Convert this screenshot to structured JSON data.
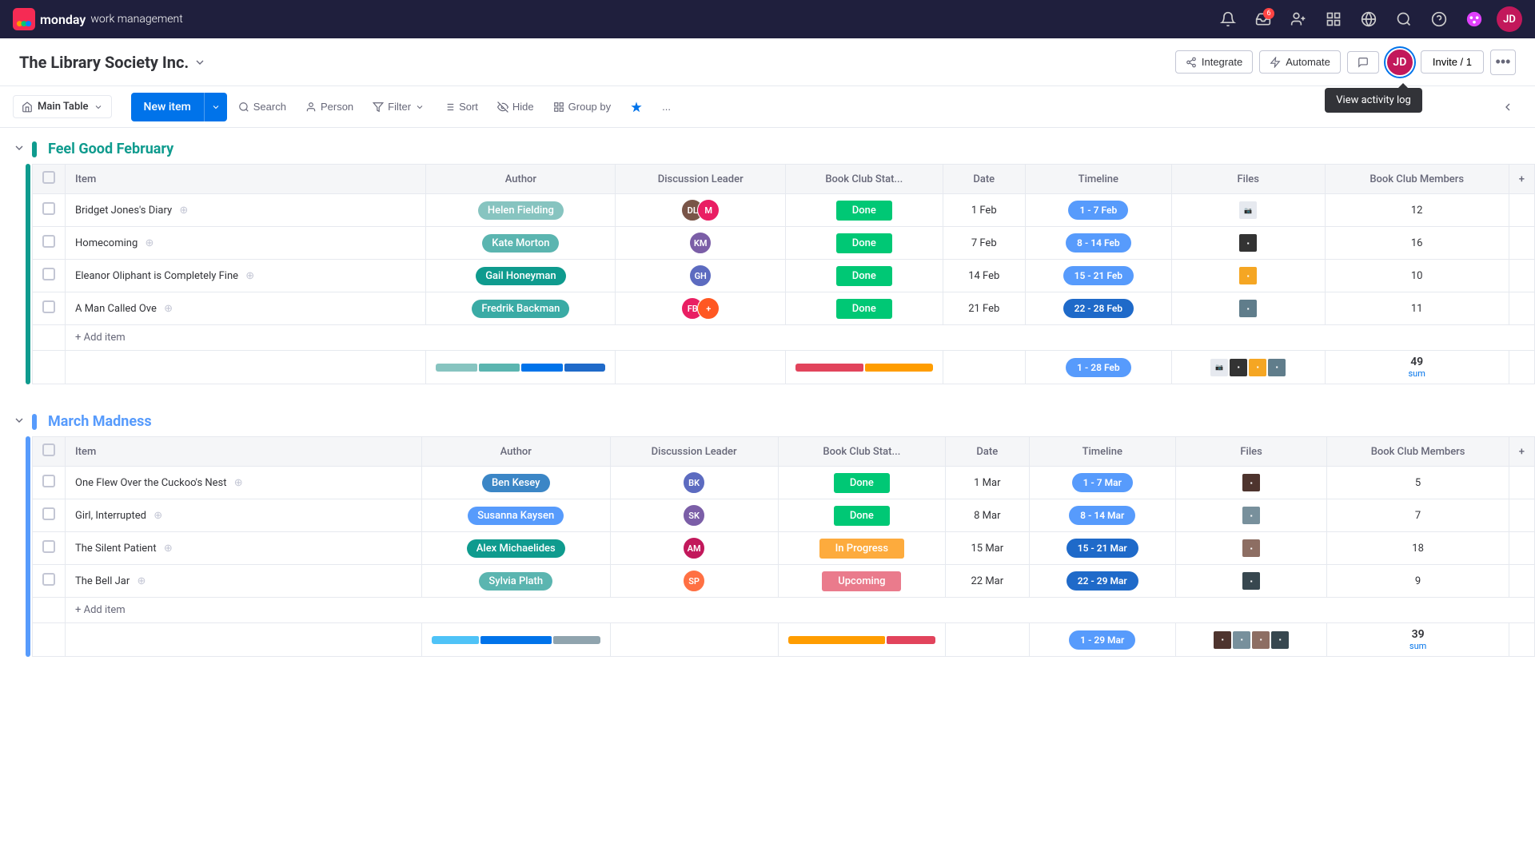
{
  "app": {
    "name": "monday",
    "subtitle": "work management"
  },
  "workspace": {
    "title": "The Library Society Inc.",
    "integrate_label": "Integrate",
    "automate_label": "Automate",
    "invite_label": "Invite / 1"
  },
  "toolbar": {
    "table_label": "Main Table",
    "new_item_label": "New item",
    "search_label": "Search",
    "person_label": "Person",
    "filter_label": "Filter",
    "sort_label": "Sort",
    "hide_label": "Hide",
    "group_by_label": "Group by",
    "more_label": "..."
  },
  "activity_log": {
    "label": "View activity log"
  },
  "groups": [
    {
      "id": "feel_good_feb",
      "title": "Feel Good February",
      "color": "teal",
      "columns": [
        "Item",
        "Author",
        "Discussion Leader",
        "Book Club Stat...",
        "Date",
        "Timeline",
        "Files",
        "Book Club Members"
      ],
      "rows": [
        {
          "item": "Bridget Jones's Diary",
          "author": "Helen Fielding",
          "author_color": "teal-light",
          "discussion_leader_initials": "DL",
          "status": "Done",
          "status_class": "done",
          "date": "1 Feb",
          "timeline": "1 - 7 Feb",
          "timeline_class": "blue",
          "files_count": 1,
          "members": 12
        },
        {
          "item": "Homecoming",
          "author": "Kate Morton",
          "author_color": "teal-lighter",
          "discussion_leader_initials": "KM",
          "status": "Done",
          "status_class": "done",
          "date": "7 Feb",
          "timeline": "8 - 14 Feb",
          "timeline_class": "blue",
          "files_count": 1,
          "members": 16
        },
        {
          "item": "Eleanor Oliphant is Completely Fine",
          "author": "Gail Honeyman",
          "author_color": "teal",
          "discussion_leader_initials": "GH",
          "status": "Done",
          "status_class": "done",
          "date": "14 Feb",
          "timeline": "15 - 21 Feb",
          "timeline_class": "blue",
          "files_count": 1,
          "members": 10
        },
        {
          "item": "A Man Called Ove",
          "author": "Fredrik Backman",
          "author_color": "teal-mid",
          "discussion_leader_initials": "FB",
          "status": "Done",
          "status_class": "done",
          "date": "21 Feb",
          "timeline": "22 - 28 Feb",
          "timeline_class": "dark-blue",
          "files_count": 1,
          "members": 11
        }
      ],
      "summary_timeline": "1 - 28 Feb",
      "summary_members": 49
    },
    {
      "id": "march_madness",
      "title": "March Madness",
      "color": "blue",
      "columns": [
        "Item",
        "Author",
        "Discussion Leader",
        "Book Club Stat...",
        "Date",
        "Timeline",
        "Files",
        "Book Club Members"
      ],
      "rows": [
        {
          "item": "One Flew Over the Cuckoo's Nest",
          "author": "Ben Kesey",
          "author_color": "blue-dark",
          "discussion_leader_initials": "BK",
          "status": "Done",
          "status_class": "done",
          "date": "1 Mar",
          "timeline": "1 - 7 Mar",
          "timeline_class": "blue",
          "files_count": 1,
          "members": 5
        },
        {
          "item": "Girl, Interrupted",
          "author": "Susanna Kaysen",
          "author_color": "blue",
          "discussion_leader_initials": "SK",
          "status": "Done",
          "status_class": "done",
          "date": "8 Mar",
          "timeline": "8 - 14 Mar",
          "timeline_class": "blue",
          "files_count": 1,
          "members": 7
        },
        {
          "item": "The Silent Patient",
          "author": "Alex Michaelides",
          "author_color": "teal",
          "discussion_leader_initials": "AM",
          "status": "In Progress",
          "status_class": "in-progress",
          "date": "15 Mar",
          "timeline": "15 - 21 Mar",
          "timeline_class": "dark-blue",
          "files_count": 1,
          "members": 18
        },
        {
          "item": "The Bell Jar",
          "author": "Sylvia Plath",
          "author_color": "teal-lighter",
          "discussion_leader_initials": "SP",
          "status": "Upcoming",
          "status_class": "upcoming",
          "date": "22 Mar",
          "timeline": "22 - 29 Mar",
          "timeline_class": "dark-blue",
          "files_count": 1,
          "members": 9
        }
      ],
      "summary_timeline": "1 - 29 Mar",
      "summary_members": 39
    }
  ],
  "nav_icons": [
    {
      "name": "bell-icon",
      "symbol": "🔔"
    },
    {
      "name": "inbox-icon",
      "symbol": "📥"
    },
    {
      "name": "invite-icon",
      "symbol": "👤"
    },
    {
      "name": "apps-icon",
      "symbol": "⊞"
    },
    {
      "name": "globe-icon",
      "symbol": "🌐"
    },
    {
      "name": "search-icon",
      "symbol": "🔍"
    },
    {
      "name": "help-icon",
      "symbol": "?"
    }
  ]
}
